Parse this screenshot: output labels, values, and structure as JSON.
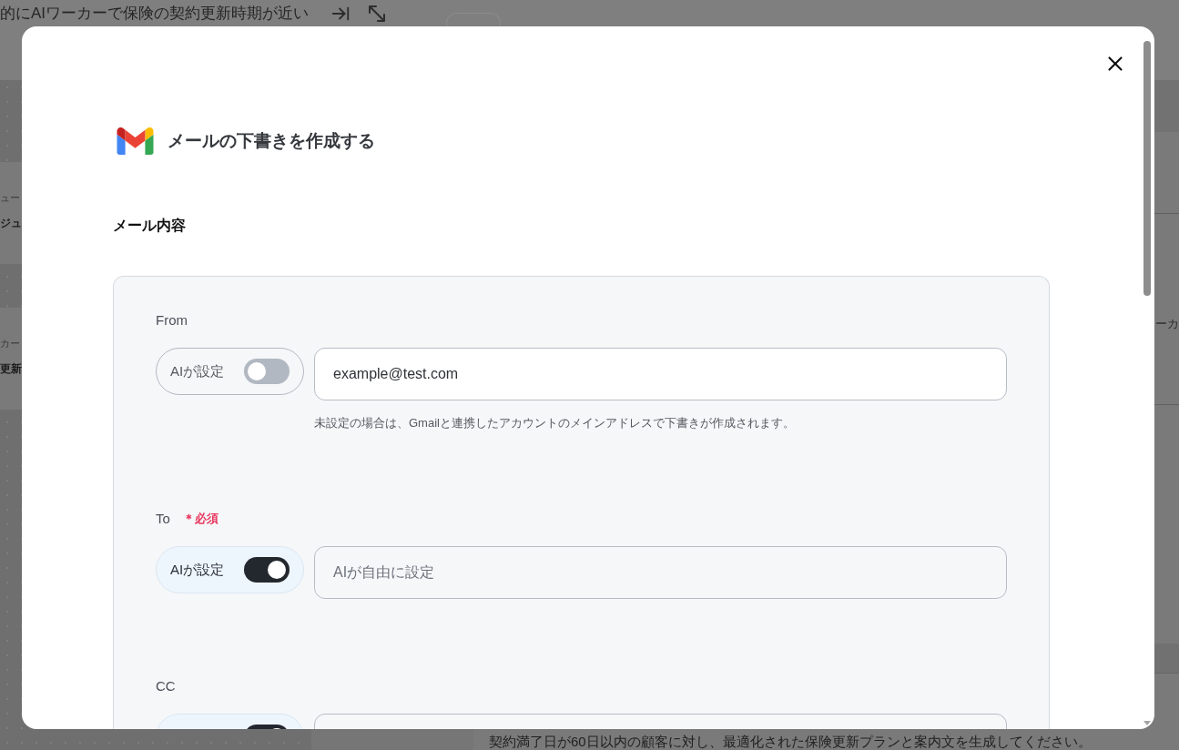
{
  "background": {
    "header_title": "的にAIワーカーで保険の契約更新時期が近い",
    "left_cards": [
      {
        "subtitle": "ュー",
        "title": "ジュ"
      },
      {
        "subtitle": "カー",
        "title": "更新"
      }
    ],
    "right_fragment": "ーカ",
    "prompt_text": "契約満了日が60日以内の顧客に対し、最適化された保険更新プランと案内文を生成してください。"
  },
  "dialog": {
    "title": "メールの下書きを作成する",
    "section_title": "メール内容",
    "fields": [
      {
        "label": "From",
        "ai_toggle": {
          "label": "AIが設定",
          "on": false
        },
        "input": {
          "value": "example@test.com"
        },
        "hint": "未設定の場合は、Gmailと連携したアカウントのメインアドレスで下書きが作成されます。"
      },
      {
        "label": "To",
        "required_label": "＊必須",
        "ai_toggle": {
          "label": "AIが設定",
          "on": true
        },
        "input": {
          "placeholder": "AIが自由に設定"
        }
      },
      {
        "label": "CC",
        "ai_toggle": {
          "on": true
        }
      }
    ]
  }
}
